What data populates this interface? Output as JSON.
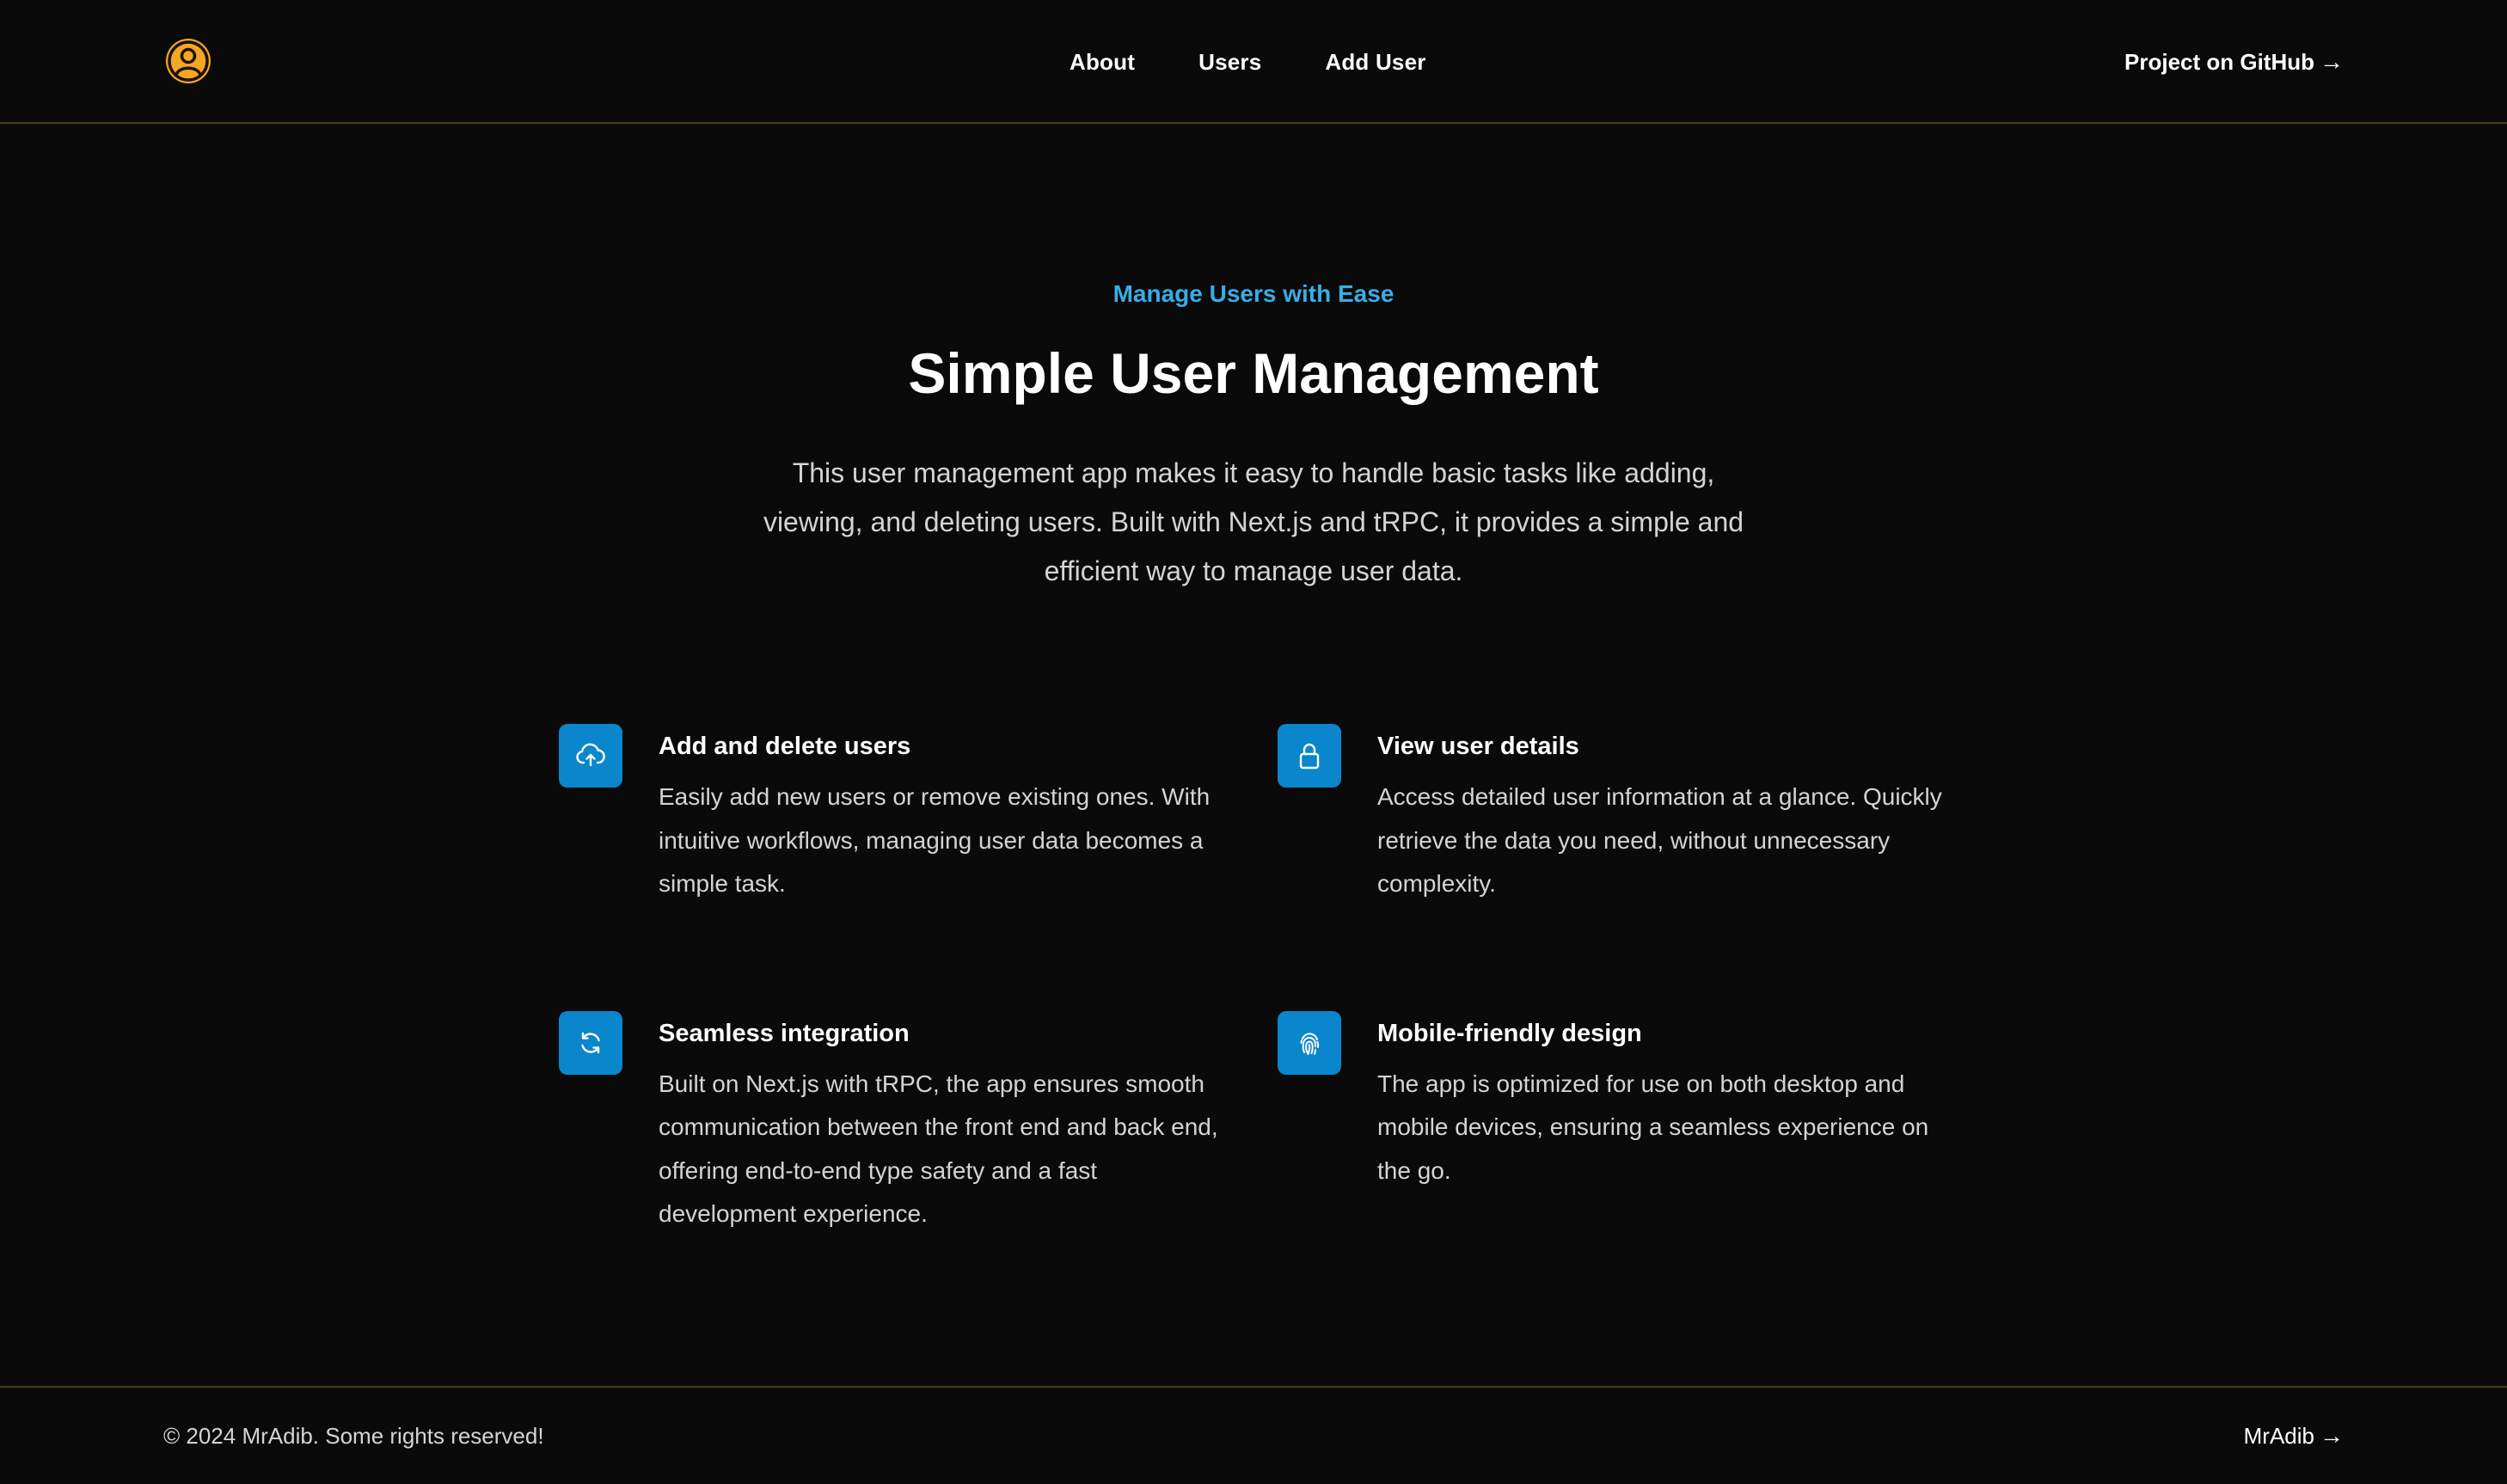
{
  "header": {
    "logo_icon": "user-circle-icon",
    "accent_color": "#f5a623",
    "nav": [
      {
        "label": "About"
      },
      {
        "label": "Users"
      },
      {
        "label": "Add User"
      }
    ],
    "github_label": "Project on GitHub",
    "arrow": "→"
  },
  "hero": {
    "eyebrow": "Manage Users with Ease",
    "title": "Simple User Management",
    "description": "This user management app makes it easy to handle basic tasks like adding, viewing, and deleting users. Built with Next.js and tRPC, it provides a simple and efficient way to manage user data."
  },
  "features": [
    {
      "icon": "cloud-upload-icon",
      "title": "Add and delete users",
      "description": "Easily add new users or remove existing ones. With intuitive workflows, managing user data becomes a simple task."
    },
    {
      "icon": "lock-icon",
      "title": "View user details",
      "description": "Access detailed user information at a glance. Quickly retrieve the data you need, without unnecessary complexity."
    },
    {
      "icon": "refresh-icon",
      "title": "Seamless integration",
      "description": "Built on Next.js with tRPC, the app ensures smooth communication between the front end and back end, offering end-to-end type safety and a fast development experience."
    },
    {
      "icon": "fingerprint-icon",
      "title": "Mobile-friendly design",
      "description": "The app is optimized for use on both desktop and mobile devices, ensuring a seamless experience on the go."
    }
  ],
  "colors": {
    "background": "#0a0a0a",
    "eyebrow": "#38aee6",
    "icon_bg": "#0a86cc",
    "divider": "#4a3a24"
  },
  "footer": {
    "copyright": "© 2024 MrAdib. Some rights reserved!",
    "author_label": "MrAdib",
    "arrow": "→"
  }
}
